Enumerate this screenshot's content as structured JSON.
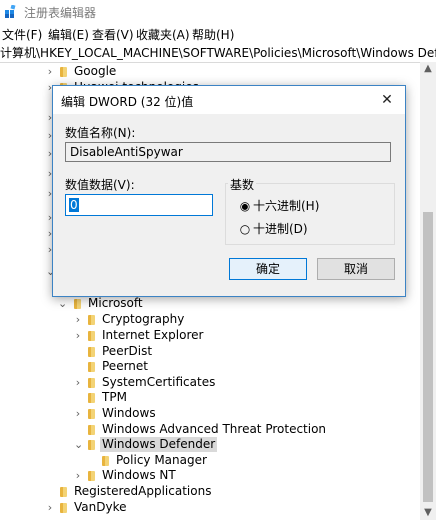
{
  "window": {
    "title": "注册表编辑器"
  },
  "menu": [
    {
      "label": "文件(F)"
    },
    {
      "label": "编辑(E)"
    },
    {
      "label": "查看(V)"
    },
    {
      "label": "收藏夹(A)"
    },
    {
      "label": "帮助(H)"
    }
  ],
  "address": "计算机\\HKEY_LOCAL_MACHINE\\SOFTWARE\\Policies\\Microsoft\\Windows Defender",
  "tree": {
    "top_items": [
      {
        "label": "Google"
      },
      {
        "label": "Huawei technologies"
      }
    ],
    "items": [
      {
        "label": "Microsoft"
      },
      {
        "label": "Cryptography"
      },
      {
        "label": "Internet Explorer"
      },
      {
        "label": "PeerDist"
      },
      {
        "label": "Peernet"
      },
      {
        "label": "SystemCertificates"
      },
      {
        "label": "TPM"
      },
      {
        "label": "Windows"
      },
      {
        "label": "Windows Advanced Threat Protection"
      },
      {
        "label": "Windows Defender"
      },
      {
        "label": "Policy Manager"
      },
      {
        "label": "Windows NT"
      },
      {
        "label": "RegisteredApplications"
      },
      {
        "label": "VanDyke"
      }
    ]
  },
  "dialog": {
    "title": "编辑 DWORD (32 位)值",
    "close_glyph": "✕",
    "name_label": "数值名称(N):",
    "name_value": "DisableAntiSpywar",
    "data_label": "数值数据(V):",
    "data_value": "0",
    "base_label": "基数",
    "radio_hex": "十六进制(H)",
    "radio_dec": "十进制(D)",
    "radio_hex_checked": true,
    "ok_label": "确定",
    "cancel_label": "取消"
  },
  "colors": {
    "accent": "#0078d7",
    "folder": "#e8b43e"
  }
}
